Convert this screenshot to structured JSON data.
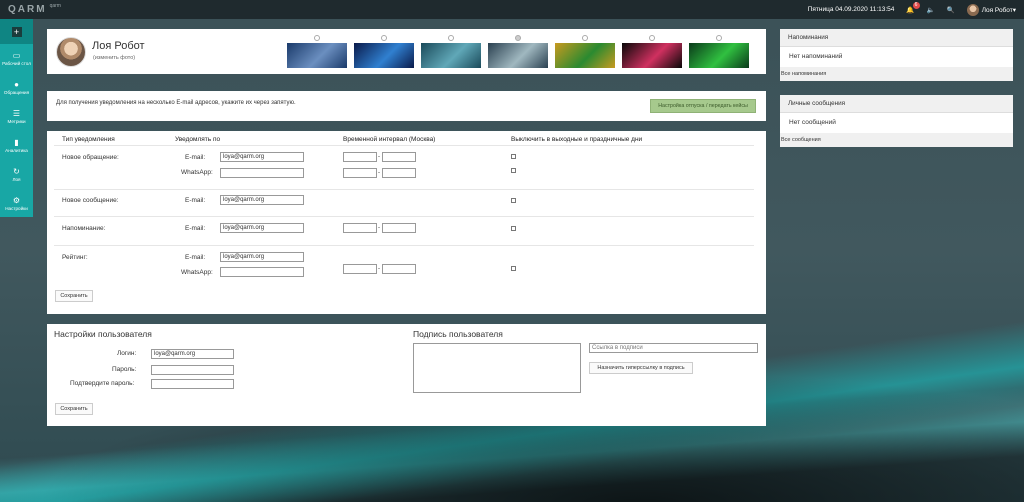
{
  "app": {
    "logo": "QARM",
    "logo_sub": "qarm"
  },
  "topbar": {
    "datetime": "Пятница 04.09.2020 11:13:54",
    "notif_count": "6",
    "user_name": "Лоя Робот▾"
  },
  "sidebar": {
    "add": "+",
    "items": [
      {
        "icon": "monitor-icon",
        "glyph": "▭",
        "label": "Рабочий стол"
      },
      {
        "icon": "chat-icon",
        "glyph": "●",
        "label": "Обращения"
      },
      {
        "icon": "list-icon",
        "glyph": "☰",
        "label": "Метрики"
      },
      {
        "icon": "bar-chart-icon",
        "glyph": "▮",
        "label": "Аналитика"
      },
      {
        "icon": "loop-icon",
        "glyph": "↻",
        "label": "Лоя"
      },
      {
        "icon": "gear-icon",
        "glyph": "⚙",
        "label": "Настройки"
      }
    ]
  },
  "profile": {
    "name": "Лоя Робот",
    "change_photo": "(изменить фото)",
    "wallpapers": [
      {
        "c1": "#1a3a6a",
        "c2": "#6b8fc0",
        "selected": false
      },
      {
        "c1": "#0a1a4a",
        "c2": "#3080d0",
        "selected": false
      },
      {
        "c1": "#1a4a5a",
        "c2": "#60a8b8",
        "selected": false
      },
      {
        "c1": "#2a4050",
        "c2": "#a0b8c0",
        "selected": true
      },
      {
        "c1": "#c89a20",
        "c2": "#2a8a30",
        "selected": false
      },
      {
        "c1": "#080808",
        "c2": "#d03060",
        "selected": false
      },
      {
        "c1": "#0a3a1a",
        "c2": "#30c040",
        "selected": false
      }
    ]
  },
  "notice": {
    "text": "Для получения уведомления на несколько E-mail адресов, укажите их через запятую.",
    "button": "Настройка отпуска / передать кейсы"
  },
  "notifications": {
    "headers": [
      "Тип уведомления",
      "Уведомлять по",
      "Временной интервал (Москва)",
      "Выключить в выходные и праздничные дни"
    ],
    "email_label": "E-mail:",
    "whatsapp_label": "WhatsApp:",
    "rows": [
      {
        "type": "Новое обращение:",
        "email": "loya@qarm.org",
        "whatsapp": ""
      },
      {
        "type": "Новое сообщение:",
        "email": "loya@qarm.org"
      },
      {
        "type": "Напоминание:",
        "email": "loya@qarm.org"
      },
      {
        "type": "Рейтинг:",
        "email": "loya@qarm.org",
        "whatsapp": ""
      }
    ],
    "dash": "-",
    "save": "Сохранить"
  },
  "user_settings": {
    "title": "Настройки пользователя",
    "login_label": "Логин:",
    "login": "loya@qarm.org",
    "password_label": "Пароль:",
    "confirm_label": "Подтвердите пароль:",
    "save": "Сохранить"
  },
  "signature": {
    "title": "Подпись пользователя",
    "link_placeholder": "Ссылка в подписи",
    "assign_button": "Назначить гиперссылку в подпись"
  },
  "reminders": {
    "title": "Напоминания",
    "empty": "Нет напоминаний",
    "all": "Все напоминания"
  },
  "messages": {
    "title": "Личные сообщения",
    "empty": "Нет сообщений",
    "all": "Все сообщения"
  }
}
